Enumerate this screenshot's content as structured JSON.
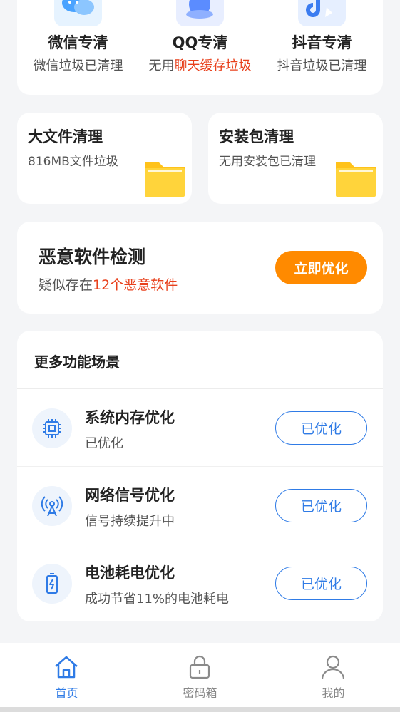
{
  "apps": [
    {
      "title": "微信专清",
      "sub": "微信垃圾已清理",
      "sub_pre": "",
      "sub_hl": ""
    },
    {
      "title": "QQ专清",
      "sub": "",
      "sub_pre": "无用",
      "sub_hl": "聊天缓存垃圾"
    },
    {
      "title": "抖音专清",
      "sub": "抖音垃圾已清理",
      "sub_pre": "",
      "sub_hl": ""
    }
  ],
  "big_file": {
    "title": "大文件清理",
    "sub": "816MB文件垃圾"
  },
  "apk": {
    "title": "安装包清理",
    "sub": "无用安装包已清理"
  },
  "malware": {
    "title": "恶意软件检测",
    "sub_pre": "疑似存在",
    "sub_hl": "12个恶意软件",
    "button": "立即优化"
  },
  "more": {
    "heading": "更多功能场景",
    "items": [
      {
        "title": "系统内存优化",
        "sub": "已优化",
        "button": "已优化",
        "icon": "chip-icon"
      },
      {
        "title": "网络信号优化",
        "sub": "信号持续提升中",
        "button": "已优化",
        "icon": "signal-tower-icon"
      },
      {
        "title": "电池耗电优化",
        "sub": "成功节省11%的电池耗电",
        "button": "已优化",
        "icon": "battery-icon"
      }
    ]
  },
  "tabs": [
    {
      "label": "首页",
      "active": true
    },
    {
      "label": "密码箱",
      "active": false
    },
    {
      "label": "我的",
      "active": false
    }
  ],
  "colors": {
    "accent": "#2f7be6",
    "orange": "#ff8a00",
    "highlight": "#e8401c",
    "folder": "#ffd43b"
  }
}
